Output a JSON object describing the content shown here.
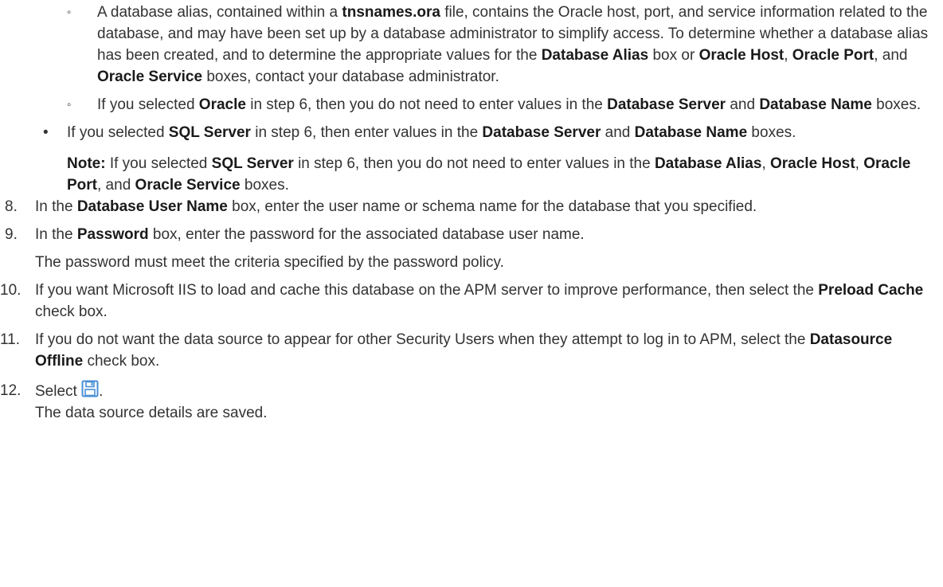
{
  "sub1": {
    "t1": "A database alias, contained within a ",
    "b1": "tnsnames.ora",
    "t2": " file, contains the Oracle host, port, and service information related to the database, and may have been set up by a database administrator to simplify access. To determine whether a database alias has been created, and to determine the appropriate values for the ",
    "b2": "Database Alias",
    "t3": " box or ",
    "b3": "Oracle Host",
    "t4": ", ",
    "b4": "Oracle Port",
    "t5": ", and ",
    "b5": "Oracle Service",
    "t6": " boxes, contact your database administrator."
  },
  "sub2": {
    "t1": "If you selected ",
    "b1": "Oracle",
    "t2": " in step 6, then you do not need to enter values in the ",
    "b2": "Database Server",
    "t3": " and ",
    "b3": "Database Name",
    "t4": " boxes."
  },
  "bullet": {
    "t1": "If you selected ",
    "b1": "SQL Server",
    "t2": " in step 6, then enter values in the ",
    "b2": "Database Server",
    "t3": " and ",
    "b3": "Database Name",
    "t4": " boxes."
  },
  "note": {
    "label": "Note:",
    "t1": " If you selected ",
    "b1": "SQL Server",
    "t2": " in step 6, then you do not need to enter values in the ",
    "b2": "Database Alias",
    "t3": ", ",
    "b3": "Oracle Host",
    "t4": ", ",
    "b4": "Oracle Port",
    "t5": ", and ",
    "b5": "Oracle Service",
    "t6": " boxes."
  },
  "step8": {
    "num": "8.",
    "t1": "In the ",
    "b1": "Database User Name",
    "t2": " box, enter the user name or schema name for the database that you specified."
  },
  "step9": {
    "num": "9.",
    "t1": "In the ",
    "b1": "Password",
    "t2": " box, enter the password for the associated database user name.",
    "result": "The password must meet the criteria specified by the password policy."
  },
  "step10": {
    "num": "10.",
    "t1": "If you want Microsoft IIS to load and cache this database on the APM server to improve performance, then select the ",
    "b1": "Preload Cache",
    "t2": " check box."
  },
  "step11": {
    "num": "11.",
    "t1": "If you do not want the data source to appear for other Security Users when they attempt to log in to APM, select the ",
    "b1": "Datasource Offline",
    "t2": " check box."
  },
  "step12": {
    "num": "12.",
    "t1": "Select ",
    "t2": ".",
    "icon": "save-icon",
    "result": "The data source details are saved."
  },
  "colors": {
    "icon_blue": "#4a8fd4"
  }
}
